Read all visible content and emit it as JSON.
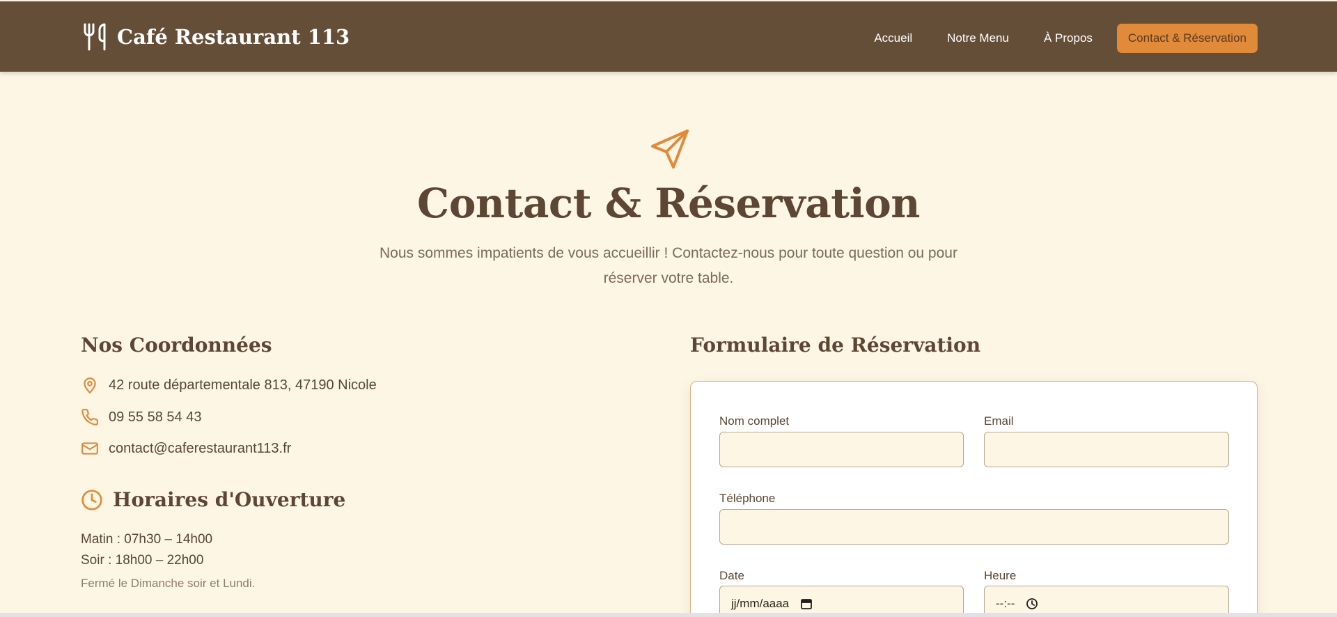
{
  "header": {
    "brand": "Café Restaurant 113",
    "nav": [
      {
        "label": "Accueil"
      },
      {
        "label": "Notre Menu"
      },
      {
        "label": "À Propos"
      },
      {
        "label": "Contact & Réservation",
        "active": true
      }
    ]
  },
  "hero": {
    "icon": "paper-plane-icon",
    "title": "Contact & Réservation",
    "subtitle": "Nous sommes impatients de vous accueillir ! Contactez-nous pour toute question ou pour réserver votre table."
  },
  "coordinates": {
    "title": "Nos Coordonnées",
    "address": "42 route départementale 813, 47190 Nicole",
    "phone": "09 55 58 54 43",
    "email": "contact@caferestaurant113.fr"
  },
  "hours": {
    "title": "Horaires d'Ouverture",
    "morning": "Matin : 07h30 – 14h00",
    "evening": "Soir : 18h00 – 22h00",
    "note": "Fermé le Dimanche soir et Lundi."
  },
  "form": {
    "title": "Formulaire de Réservation",
    "name_label": "Nom complet",
    "name_value": "",
    "email_label": "Email",
    "email_value": "",
    "phone_label": "Téléphone",
    "phone_value": "",
    "date_label": "Date",
    "date_placeholder": "jj/mm/aaaa",
    "time_label": "Heure",
    "time_placeholder": "--:--"
  },
  "colors": {
    "header_bg": "#654e38",
    "accent": "#e08a3a",
    "page_bg": "#fdf6e5",
    "text_dark": "#5d4633"
  }
}
